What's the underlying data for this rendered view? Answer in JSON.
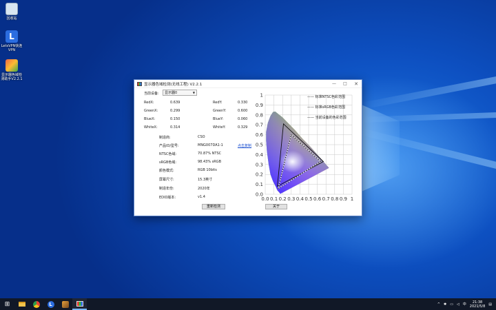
{
  "desktop": {
    "icons": [
      {
        "label": "回收站",
        "name": "recycle-bin-icon",
        "color": "#d8e6f2"
      },
      {
        "label": "LetsVPN快连VPN",
        "name": "letsvpn-icon",
        "color": "#2b6de0"
      },
      {
        "label": "显示器色域检测助手V2.2.1",
        "name": "display-gamut-tool-icon",
        "color": "#d98a2b"
      }
    ]
  },
  "window": {
    "title": "显示器色域检测(无线工程) V2.2.1",
    "minimize": "—",
    "maximize": "□",
    "close": "✕",
    "device_label": "当前设备:",
    "device_value": "显示器0",
    "chroma": [
      {
        "left_label": "RedX:",
        "left_value": "0.639",
        "right_label": "RedY:",
        "right_value": "0.330"
      },
      {
        "left_label": "GreenX:",
        "left_value": "0.299",
        "right_label": "GreenY:",
        "right_value": "0.600"
      },
      {
        "left_label": "BlueX:",
        "left_value": "0.150",
        "right_label": "BlueY:",
        "right_value": "0.060"
      },
      {
        "left_label": "WhiteX:",
        "left_value": "0.314",
        "right_label": "WhiteY:",
        "right_value": "0.329"
      }
    ],
    "info": [
      {
        "label": "制造商:",
        "value": "CSO"
      },
      {
        "label": "产品ID/型号:",
        "value": "MNG007DA1-1"
      },
      {
        "label": "NTSC色域:",
        "value": "70.87% NTSC"
      },
      {
        "label": "sRGB色域:",
        "value": "98.43% sRGB"
      },
      {
        "label": "颜色模式:",
        "value": "RGB 10bits"
      },
      {
        "label": "屏幕尺寸:",
        "value": "15.3英寸"
      },
      {
        "label": "制造年份:",
        "value": "2020年"
      },
      {
        "label": "EDID版本:",
        "value": "v1.4"
      }
    ],
    "copy_link": "点击复制",
    "redetect_button": "重新检测",
    "about_button": "关于"
  },
  "chart_data": {
    "type": "scatter",
    "title": "",
    "xlim": [
      0,
      1
    ],
    "ylim": [
      0,
      1
    ],
    "x_ticks": [
      "0.0",
      "0.1",
      "0.2",
      "0.3",
      "0.4",
      "0.5",
      "0.6",
      "0.7",
      "0.8",
      "0.9",
      "1"
    ],
    "y_ticks": [
      "0.0",
      "0.1",
      "0.2",
      "0.3",
      "0.4",
      "0.5",
      "0.6",
      "0.7",
      "0.8",
      "0.9",
      "1"
    ],
    "grid": true,
    "legend_position": "top-right",
    "legend": [
      "—— 标准NTSC色彩范围",
      "—— 标准sRGB色彩范围",
      "—— 当前设备的色彩范围"
    ],
    "series": [
      {
        "name": "标准NTSC色彩范围",
        "color": "#111111",
        "dash": "solid",
        "points": [
          [
            0.67,
            0.33
          ],
          [
            0.21,
            0.71
          ],
          [
            0.14,
            0.08
          ]
        ]
      },
      {
        "name": "标准sRGB色彩范围",
        "color": "#ffffff",
        "dash": "solid",
        "points": [
          [
            0.64,
            0.33
          ],
          [
            0.3,
            0.6
          ],
          [
            0.15,
            0.06
          ]
        ]
      },
      {
        "name": "当前设备的色彩范围",
        "color": "#111111",
        "dash": "dashed",
        "points": [
          [
            0.639,
            0.33
          ],
          [
            0.299,
            0.6
          ],
          [
            0.15,
            0.06
          ]
        ]
      }
    ],
    "white_point": [
      0.314,
      0.329
    ]
  },
  "taskbar": {
    "items": [
      {
        "name": "start-button",
        "glyph": "⊞"
      },
      {
        "name": "file-explorer-icon",
        "glyph": "▆"
      },
      {
        "name": "chrome-icon",
        "glyph": "●"
      },
      {
        "name": "letsvpn-taskbar-icon",
        "glyph": "L"
      },
      {
        "name": "tool-taskbar-icon",
        "glyph": "✱"
      },
      {
        "name": "display-gamut-taskbar-icon",
        "glyph": "▣"
      }
    ],
    "tray_chevron": "^",
    "ime": "中",
    "time": "21:38",
    "date": "2021/5/8"
  }
}
